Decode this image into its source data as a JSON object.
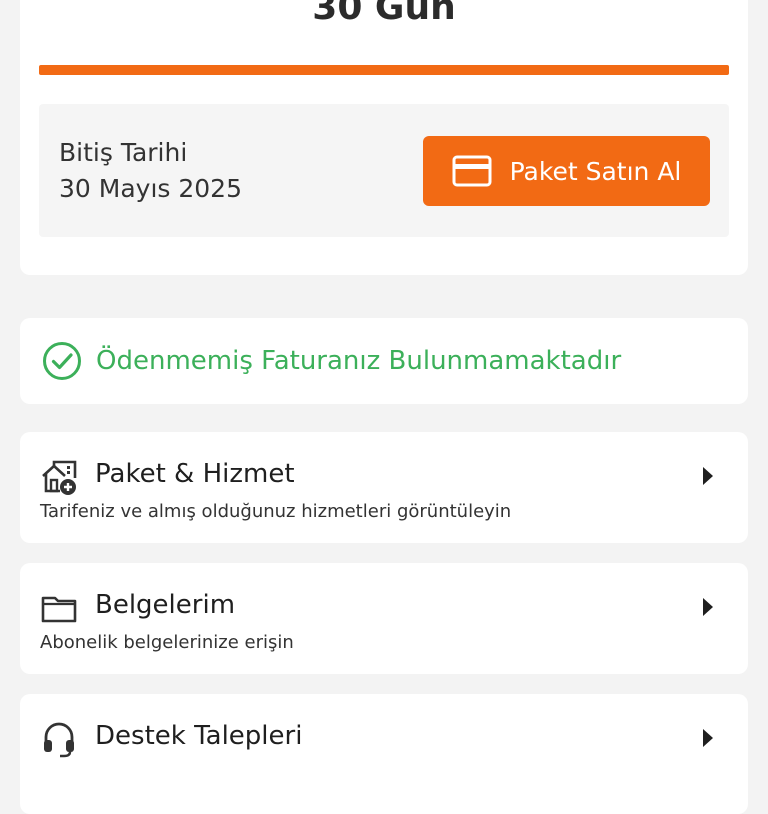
{
  "package": {
    "remaining_days": "30 Gün",
    "progress_fraction": 1.0,
    "expiry_label": "Bitiş Tarihi",
    "expiry_date": "30 Mayıs 2025",
    "buy_button_label": "Paket Satın Al",
    "buy_button_icon": "credit-card-icon"
  },
  "invoice": {
    "status_text": "Ödenmemiş Faturanız Bulunmamaktadır",
    "icon": "check-circle-icon"
  },
  "menu": [
    {
      "title": "Paket & Hizmet",
      "description": "Tarifeniz ve almış olduğunuz hizmetleri görüntüleyin",
      "icon": "home-add-icon"
    },
    {
      "title": "Belgelerim",
      "description": "Abonelik belgelerinize erişin",
      "icon": "folder-icon"
    },
    {
      "title": "Destek Talepleri",
      "description": "",
      "icon": "headset-icon"
    }
  ],
  "colors": {
    "accent": "#f26a14",
    "success": "#3cb05a",
    "background": "#f3f3f3",
    "card": "#ffffff"
  }
}
